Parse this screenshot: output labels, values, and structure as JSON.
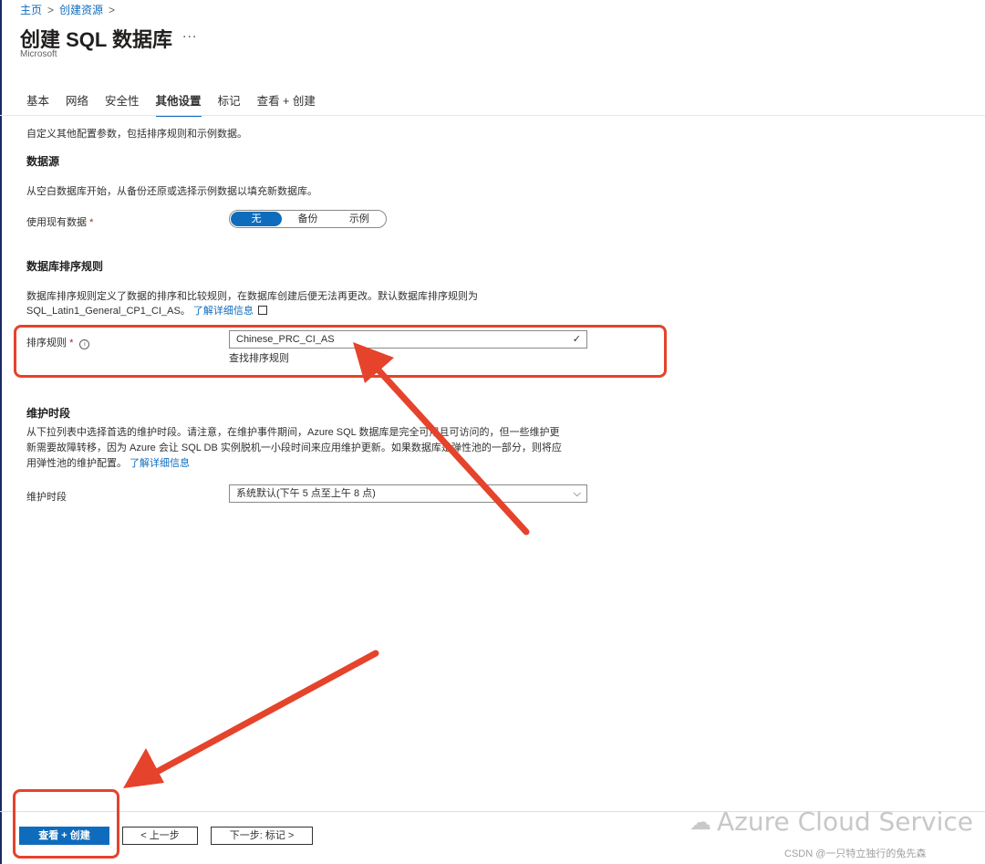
{
  "breadcrumb": {
    "home": "主页",
    "create": "创建资源",
    "sep": ">"
  },
  "page": {
    "title": "创建 SQL 数据库",
    "more": "...",
    "publisher": "Microsoft"
  },
  "tabs": [
    {
      "label": "基本"
    },
    {
      "label": "网络"
    },
    {
      "label": "安全性"
    },
    {
      "label": "其他设置"
    },
    {
      "label": "标记"
    },
    {
      "label": "查看 + 创建"
    }
  ],
  "intro": "自定义其他配置参数，包括排序规则和示例数据。",
  "datasource": {
    "heading": "数据源",
    "desc": "从空白数据库开始，从备份还原或选择示例数据以填充新数据库。",
    "label": "使用现有数据",
    "required": "*",
    "options": [
      "无",
      "备份",
      "示例"
    ],
    "selected": "无"
  },
  "collation": {
    "heading": "数据库排序规则",
    "desc1": "数据库排序规则定义了数据的排序和比较规则，在数据库创建后便无法再更改。默认数据库排序规则为",
    "desc2": "SQL_Latin1_General_CP1_CI_AS。",
    "learn_more": "了解详细信息",
    "label": "排序规则",
    "required": "*",
    "value": "Chinese_PRC_CI_AS",
    "find_link": "查找排序规则"
  },
  "maintenance": {
    "heading": "维护时段",
    "desc1": "从下拉列表中选择首选的维护时段。请注意，在维护事件期间，Azure SQL 数据库是完全可用且可访问的，但一些维护更",
    "desc2": "新需要故障转移，因为 Azure 会让 SQL DB 实例脱机一小段时间来应用维护更新。如果数据库是弹性池的一部分，则将应",
    "desc3": "用弹性池的维护配置。",
    "learn_more": "了解详细信息",
    "label": "维护时段",
    "value": "系统默认(下午 5 点至上午 8 点)"
  },
  "footer": {
    "review_create": "查看 + 创建",
    "prev": "< 上一步",
    "next": "下一步: 标记 >"
  },
  "watermark": {
    "text": "Azure Cloud Service",
    "credit": "CSDN @一只特立独行的兔先森"
  },
  "colors": {
    "accent": "#0f6cbd",
    "annotation": "#e5432b"
  }
}
